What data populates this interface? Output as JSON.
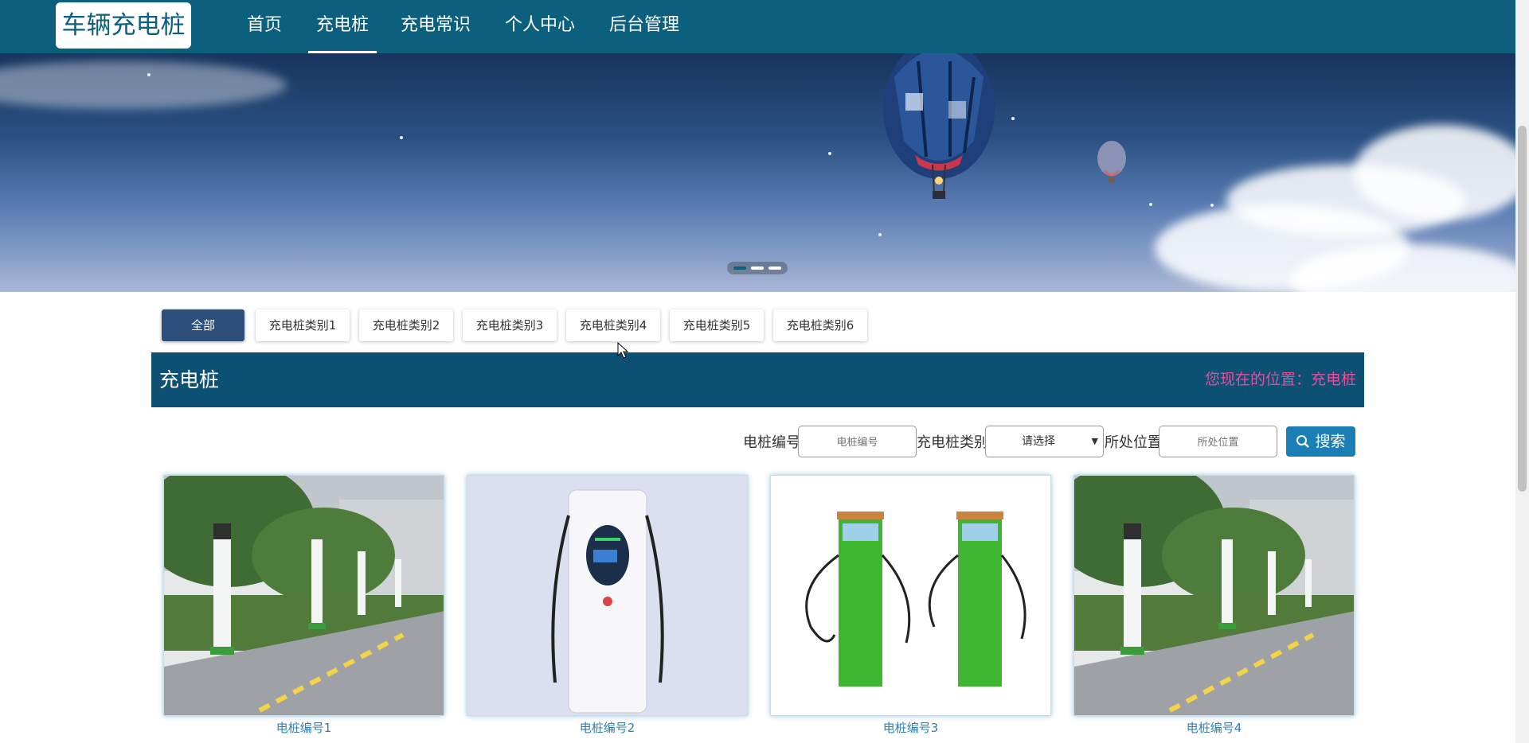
{
  "header": {
    "logo": "车辆充电桩",
    "nav": [
      {
        "label": "首页",
        "active": false
      },
      {
        "label": "充电桩",
        "active": true
      },
      {
        "label": "充电常识",
        "active": false
      },
      {
        "label": "个人中心",
        "active": false
      },
      {
        "label": "后台管理",
        "active": false
      }
    ]
  },
  "banner": {
    "slides": 3,
    "active_slide": 1
  },
  "categories": [
    "全部",
    "充电桩类别1",
    "充电桩类别2",
    "充电桩类别3",
    "充电桩类别4",
    "充电桩类别5",
    "充电桩类别6"
  ],
  "active_category": "全部",
  "section": {
    "title": "充电桩",
    "location_label": "您现在的位置：",
    "location_value": "充电桩"
  },
  "search": {
    "code_label": "电桩编号",
    "code_placeholder": "电桩编号",
    "category_label": "充电桩类别",
    "category_selected": "请选择",
    "position_label": "所处位置",
    "position_placeholder": "所处位置",
    "button_label": "搜索"
  },
  "items": [
    {
      "name": "电桩编号1",
      "image": "roadside-chargers-photo"
    },
    {
      "name": "电桩编号2",
      "image": "white-dc-charger-photo"
    },
    {
      "name": "电桩编号3",
      "image": "green-ac-chargers-photo"
    },
    {
      "name": "电桩编号4",
      "image": "roadside-chargers-photo"
    }
  ],
  "colors": {
    "nav_bg": "#0c5f7d",
    "title_bar_bg": "#0c5074",
    "active_category_bg": "#2c4f7c",
    "search_button_bg": "#1a7fb5",
    "location_text": "#e84d9a",
    "item_name_text": "#2f7fb6"
  }
}
